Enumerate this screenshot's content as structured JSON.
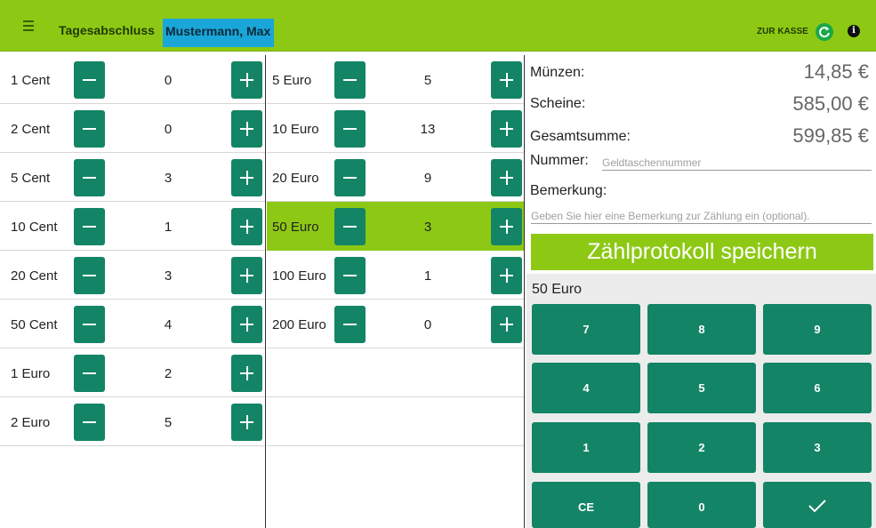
{
  "header": {
    "title": "Tagesabschluss",
    "user": "Mustermann, Max",
    "zur_kasse": "ZUR KASSE",
    "info_glyph": "i",
    "icons": [
      "menu-icon",
      "refresh-icon",
      "info-icon"
    ],
    "bar_color": "#8dc914",
    "user_highlight_color": "#1aa6d8"
  },
  "coins": [
    {
      "label": "1 Cent",
      "count": "0"
    },
    {
      "label": "2 Cent",
      "count": "0"
    },
    {
      "label": "5 Cent",
      "count": "3"
    },
    {
      "label": "10 Cent",
      "count": "1"
    },
    {
      "label": "20 Cent",
      "count": "3"
    },
    {
      "label": "50 Cent",
      "count": "4"
    },
    {
      "label": "1 Euro",
      "count": "2"
    },
    {
      "label": "2 Euro",
      "count": "5"
    }
  ],
  "notes": [
    {
      "label": "5 Euro",
      "count": "5"
    },
    {
      "label": "10 Euro",
      "count": "13"
    },
    {
      "label": "20 Euro",
      "count": "9"
    },
    {
      "label": "50 Euro",
      "count": "3",
      "selected": true
    },
    {
      "label": "100 Euro",
      "count": "1"
    },
    {
      "label": "200 Euro",
      "count": "0"
    }
  ],
  "summary": {
    "muenzen_label": "Münzen:",
    "muenzen_value": "14,85 €",
    "scheine_label": "Scheine:",
    "scheine_value": "585,00 €",
    "gesamt_label": "Gesamtsumme:",
    "gesamt_value": "599,85 €"
  },
  "form": {
    "nummer_label": "Nummer:",
    "nummer_placeholder": "Geldtaschennummer",
    "bemerkung_label": "Bemerkung:",
    "bemerkung_placeholder": "Geben Sie hier eine Bemerkung zur Zählung ein (optional)."
  },
  "save_button": "Zählprotokoll speichern",
  "keypad": {
    "selected_label": "50 Euro",
    "keys": [
      "7",
      "8",
      "9",
      "4",
      "5",
      "6",
      "1",
      "2",
      "3",
      "CE",
      "0",
      "check-icon"
    ],
    "key_color": "#148466"
  }
}
